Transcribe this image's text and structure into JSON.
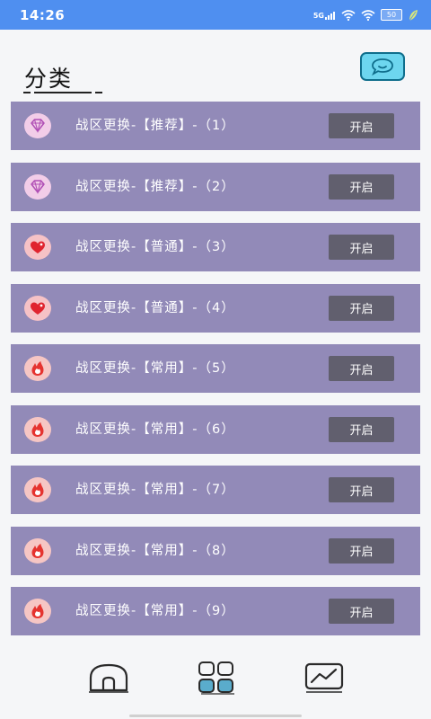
{
  "status_bar": {
    "time": "14:26",
    "network_label": "5G",
    "battery_level": "50",
    "icons": [
      "5g-signal-icon",
      "wifi-icon",
      "wifi-icon",
      "battery-icon",
      "leaf-icon"
    ]
  },
  "header": {
    "title": "分类",
    "chat_icon": "chat-bubble-icon"
  },
  "list": {
    "button_label": "开启",
    "items": [
      {
        "label": "战区更换-【推荐】-（1）",
        "icon": "diamond-icon"
      },
      {
        "label": "战区更换-【推荐】-（2）",
        "icon": "diamond-icon"
      },
      {
        "label": "战区更换-【普通】-（3）",
        "icon": "heart-icon"
      },
      {
        "label": "战区更换-【普通】-（4）",
        "icon": "heart-icon"
      },
      {
        "label": "战区更换-【常用】-（5）",
        "icon": "flame-icon"
      },
      {
        "label": "战区更换-【常用】-（6）",
        "icon": "flame-icon"
      },
      {
        "label": "战区更换-【常用】-（7）",
        "icon": "flame-icon"
      },
      {
        "label": "战区更换-【常用】-（8）",
        "icon": "flame-icon"
      },
      {
        "label": "战区更换-【常用】-（9）",
        "icon": "flame-icon"
      }
    ]
  },
  "bottom_nav": {
    "items": [
      {
        "name": "home",
        "icon": "home-icon"
      },
      {
        "name": "category",
        "icon": "grid-icon",
        "active": true
      },
      {
        "name": "stats",
        "icon": "chart-icon"
      }
    ]
  },
  "colors": {
    "status_bar": "#4f8ff0",
    "row_background": "#928ab8",
    "button_background": "#615f6e",
    "chat_button": "#6dd6ef",
    "active_nav": "#5aaccc"
  }
}
